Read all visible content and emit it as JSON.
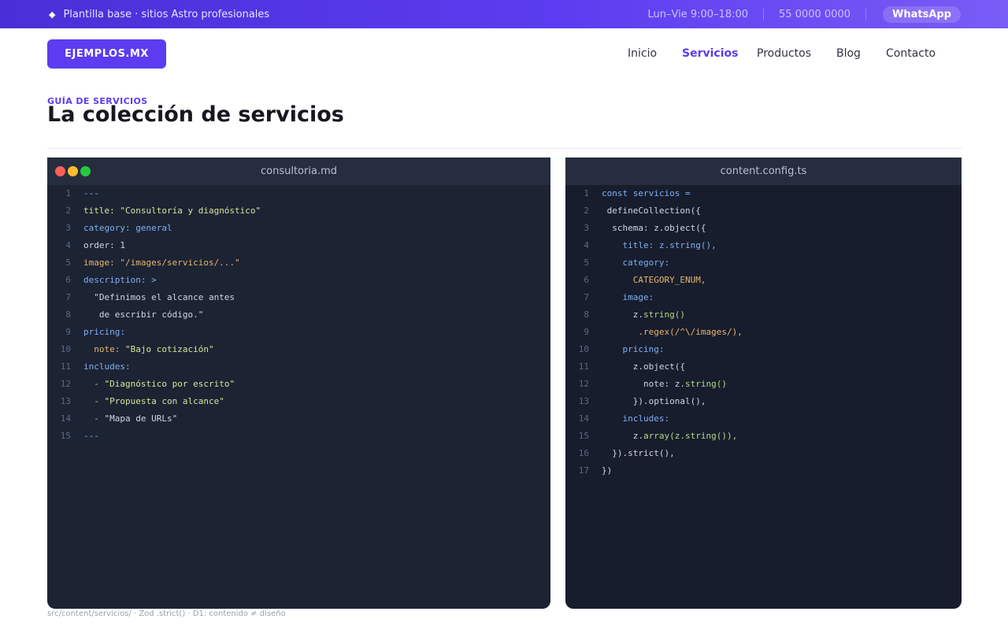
{
  "topbar": {
    "tagline": "Plantilla base · sitios Astro profesionales",
    "hours": "Lun–Vie  9:00–18:00",
    "phone": "55 0000 0000",
    "whatsapp": "WhatsApp"
  },
  "header": {
    "logo": "EJEMPLOS.MX",
    "nav": [
      {
        "label": "Inicio",
        "active": false
      },
      {
        "label": "Servicios",
        "active": true
      },
      {
        "label": "Productos",
        "active": false
      },
      {
        "label": "Blog",
        "active": false
      },
      {
        "label": "Contacto",
        "active": false
      }
    ]
  },
  "page": {
    "eyebrow": "GUÍA DE SERVICIOS",
    "title": "La colección de servicios",
    "footer_note": "src/content/servicios/ · Zod .strict() · D1: contenido ≠ diseño"
  },
  "editors": [
    {
      "filename": "consultoria.md",
      "lines": [
        {
          "n": "1",
          "parts": [
            {
              "t": "---",
              "c": "c-key"
            }
          ]
        },
        {
          "n": "2",
          "parts": [
            {
              "t": "title: ",
              "c": "c-str"
            },
            {
              "t": "\"Consultoría y diagnóstico\"",
              "c": "c-str"
            }
          ]
        },
        {
          "n": "3",
          "parts": [
            {
              "t": "category: general",
              "c": "c-key"
            }
          ]
        },
        {
          "n": "4",
          "parts": [
            {
              "t": "order: 1",
              "c": "c-plain"
            }
          ]
        },
        {
          "n": "5",
          "parts": [
            {
              "t": "image: \"/images/servicios/...\"",
              "c": "c-orange"
            }
          ]
        },
        {
          "n": "6",
          "parts": [
            {
              "t": "description: >",
              "c": "c-key"
            }
          ]
        },
        {
          "n": "7",
          "parts": [
            {
              "t": "  \"Definimos el alcance antes",
              "c": "c-plain"
            }
          ]
        },
        {
          "n": "8",
          "parts": [
            {
              "t": "   de escribir código.\"",
              "c": "c-plain"
            }
          ]
        },
        {
          "n": "9",
          "parts": [
            {
              "t": "pricing:",
              "c": "c-key"
            }
          ]
        },
        {
          "n": "10",
          "parts": [
            {
              "t": "  note: ",
              "c": "c-orange"
            },
            {
              "t": "\"Bajo cotización\"",
              "c": "c-str"
            }
          ]
        },
        {
          "n": "11",
          "parts": [
            {
              "t": "includes:",
              "c": "c-key"
            }
          ]
        },
        {
          "n": "12",
          "parts": [
            {
              "t": "  - ",
              "c": "c-orange"
            },
            {
              "t": "\"Diagnóstico por escrito\"",
              "c": "c-str"
            }
          ]
        },
        {
          "n": "13",
          "parts": [
            {
              "t": "  - ",
              "c": "c-orange"
            },
            {
              "t": "\"Propuesta con alcance\"",
              "c": "c-str"
            }
          ]
        },
        {
          "n": "14",
          "parts": [
            {
              "t": "  - ",
              "c": "c-orange"
            },
            {
              "t": "\"Mapa de URLs\"",
              "c": "c-plain"
            }
          ]
        },
        {
          "n": "15",
          "parts": [
            {
              "t": "---",
              "c": "c-key"
            }
          ]
        }
      ]
    },
    {
      "filename": "content.config.ts",
      "lines": [
        {
          "n": "1",
          "parts": [
            {
              "t": "const servicios =",
              "c": "c-key"
            }
          ]
        },
        {
          "n": "2",
          "parts": [
            {
              "t": " defineCollection({",
              "c": "c-plain"
            }
          ]
        },
        {
          "n": "3",
          "parts": [
            {
              "t": "  schema: z.object({",
              "c": "c-plain"
            }
          ]
        },
        {
          "n": "4",
          "parts": [
            {
              "t": "    title: z.string(),",
              "c": "c-key"
            }
          ]
        },
        {
          "n": "5",
          "parts": [
            {
              "t": "    category:",
              "c": "c-key"
            }
          ]
        },
        {
          "n": "6",
          "parts": [
            {
              "t": "      CATEGORY_ENUM,",
              "c": "c-orange"
            }
          ]
        },
        {
          "n": "7",
          "parts": [
            {
              "t": "    image:",
              "c": "c-key"
            }
          ]
        },
        {
          "n": "8",
          "parts": [
            {
              "t": "      z.",
              "c": "c-plain"
            },
            {
              "t": "string()",
              "c": "c-green"
            }
          ]
        },
        {
          "n": "9",
          "parts": [
            {
              "t": "       .regex(/^\\/images/),",
              "c": "c-orange"
            }
          ]
        },
        {
          "n": "10",
          "parts": [
            {
              "t": "    pricing:",
              "c": "c-key"
            }
          ]
        },
        {
          "n": "11",
          "parts": [
            {
              "t": "      z.object({",
              "c": "c-plain"
            }
          ]
        },
        {
          "n": "12",
          "parts": [
            {
              "t": "        note: z.",
              "c": "c-plain"
            },
            {
              "t": "string()",
              "c": "c-green"
            }
          ]
        },
        {
          "n": "13",
          "parts": [
            {
              "t": "      }).optional(),",
              "c": "c-plain"
            }
          ]
        },
        {
          "n": "14",
          "parts": [
            {
              "t": "    includes:",
              "c": "c-key"
            }
          ]
        },
        {
          "n": "15",
          "parts": [
            {
              "t": "      z.",
              "c": "c-plain"
            },
            {
              "t": "array(z.string()),",
              "c": "c-green"
            }
          ]
        },
        {
          "n": "16",
          "parts": [
            {
              "t": "  }).strict(),",
              "c": "c-plain"
            }
          ]
        },
        {
          "n": "17",
          "parts": [
            {
              "t": "})",
              "c": "c-plain"
            }
          ]
        }
      ]
    }
  ],
  "colors": {
    "accent": "#5b3cf0",
    "editor_bg": "#1c2333",
    "editor_tab": "#252d3f"
  }
}
